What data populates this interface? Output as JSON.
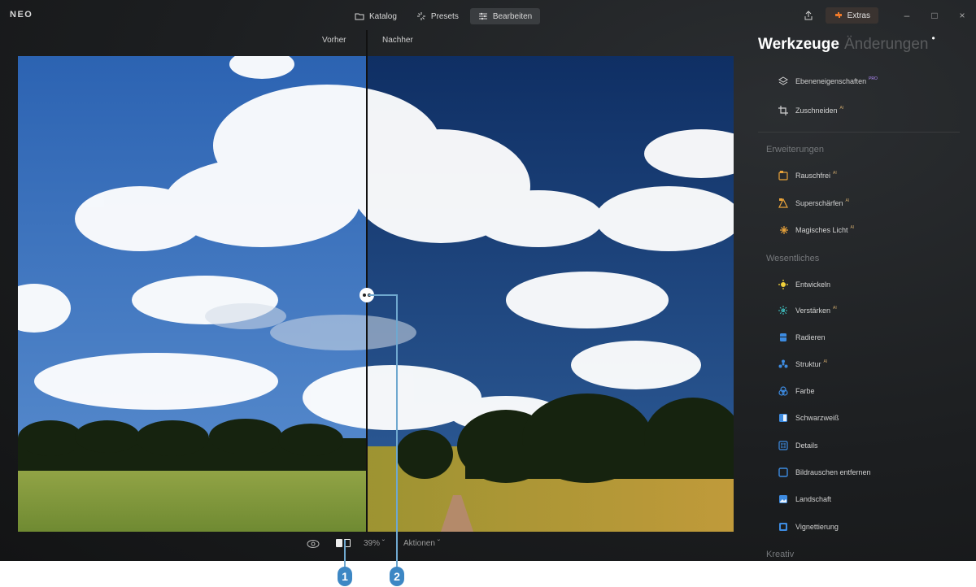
{
  "app": {
    "logo": "NEO"
  },
  "nav": [
    {
      "label": "Katalog",
      "icon": "folder-icon",
      "active": false
    },
    {
      "label": "Presets",
      "icon": "presets-icon",
      "active": false
    },
    {
      "label": "Bearbeiten",
      "icon": "sliders-icon",
      "active": true
    }
  ],
  "titlebar": {
    "extras_label": "Extras"
  },
  "compare": {
    "before_label": "Vorher",
    "after_label": "Nachher"
  },
  "bottombar": {
    "zoom": "39%",
    "actions_label": "Aktionen"
  },
  "panel": {
    "tab_tools": "Werkzeuge",
    "tab_changes": "Änderungen",
    "tab_dot": "•",
    "top_tools": [
      {
        "label": "Ebeneneigenschaften",
        "badge": "PRO",
        "icon": "layers-icon"
      },
      {
        "label": "Zuschneiden",
        "badge": "AI",
        "icon": "crop-icon"
      }
    ],
    "section_extensions": "Erweiterungen",
    "extensions": [
      {
        "label": "Rauschfrei",
        "badge": "AI",
        "icon": "noise-free-icon",
        "color": "#e8a23a"
      },
      {
        "label": "Superschärfen",
        "badge": "AI",
        "icon": "super-sharpen-icon",
        "color": "#e8a23a"
      },
      {
        "label": "Magisches Licht",
        "badge": "AI",
        "icon": "magic-light-icon",
        "color": "#e8a23a"
      }
    ],
    "section_essentials": "Wesentliches",
    "essentials": [
      {
        "label": "Entwickeln",
        "badge": "",
        "icon": "develop-icon",
        "color": "#f2d13a"
      },
      {
        "label": "Verstärken",
        "badge": "AI",
        "icon": "enhance-icon",
        "color": "#3fc7c7"
      },
      {
        "label": "Radieren",
        "badge": "",
        "icon": "eraser-icon",
        "color": "#3d8be0"
      },
      {
        "label": "Struktur",
        "badge": "AI",
        "icon": "structure-icon",
        "color": "#3d8be0"
      },
      {
        "label": "Farbe",
        "badge": "",
        "icon": "color-icon",
        "color": "#3d8be0"
      },
      {
        "label": "Schwarzweiß",
        "badge": "",
        "icon": "black-white-icon",
        "color": "#3d8be0"
      },
      {
        "label": "Details",
        "badge": "",
        "icon": "details-icon",
        "color": "#3d8be0"
      },
      {
        "label": "Bildrauschen entfernen",
        "badge": "",
        "icon": "denoise-icon",
        "color": "#3d8be0"
      },
      {
        "label": "Landschaft",
        "badge": "",
        "icon": "landscape-icon",
        "color": "#3d8be0"
      },
      {
        "label": "Vignettierung",
        "badge": "",
        "icon": "vignette-icon",
        "color": "#3d8be0"
      }
    ],
    "section_creative": "Kreativ"
  },
  "callouts": [
    {
      "number": "1"
    },
    {
      "number": "2"
    }
  ]
}
